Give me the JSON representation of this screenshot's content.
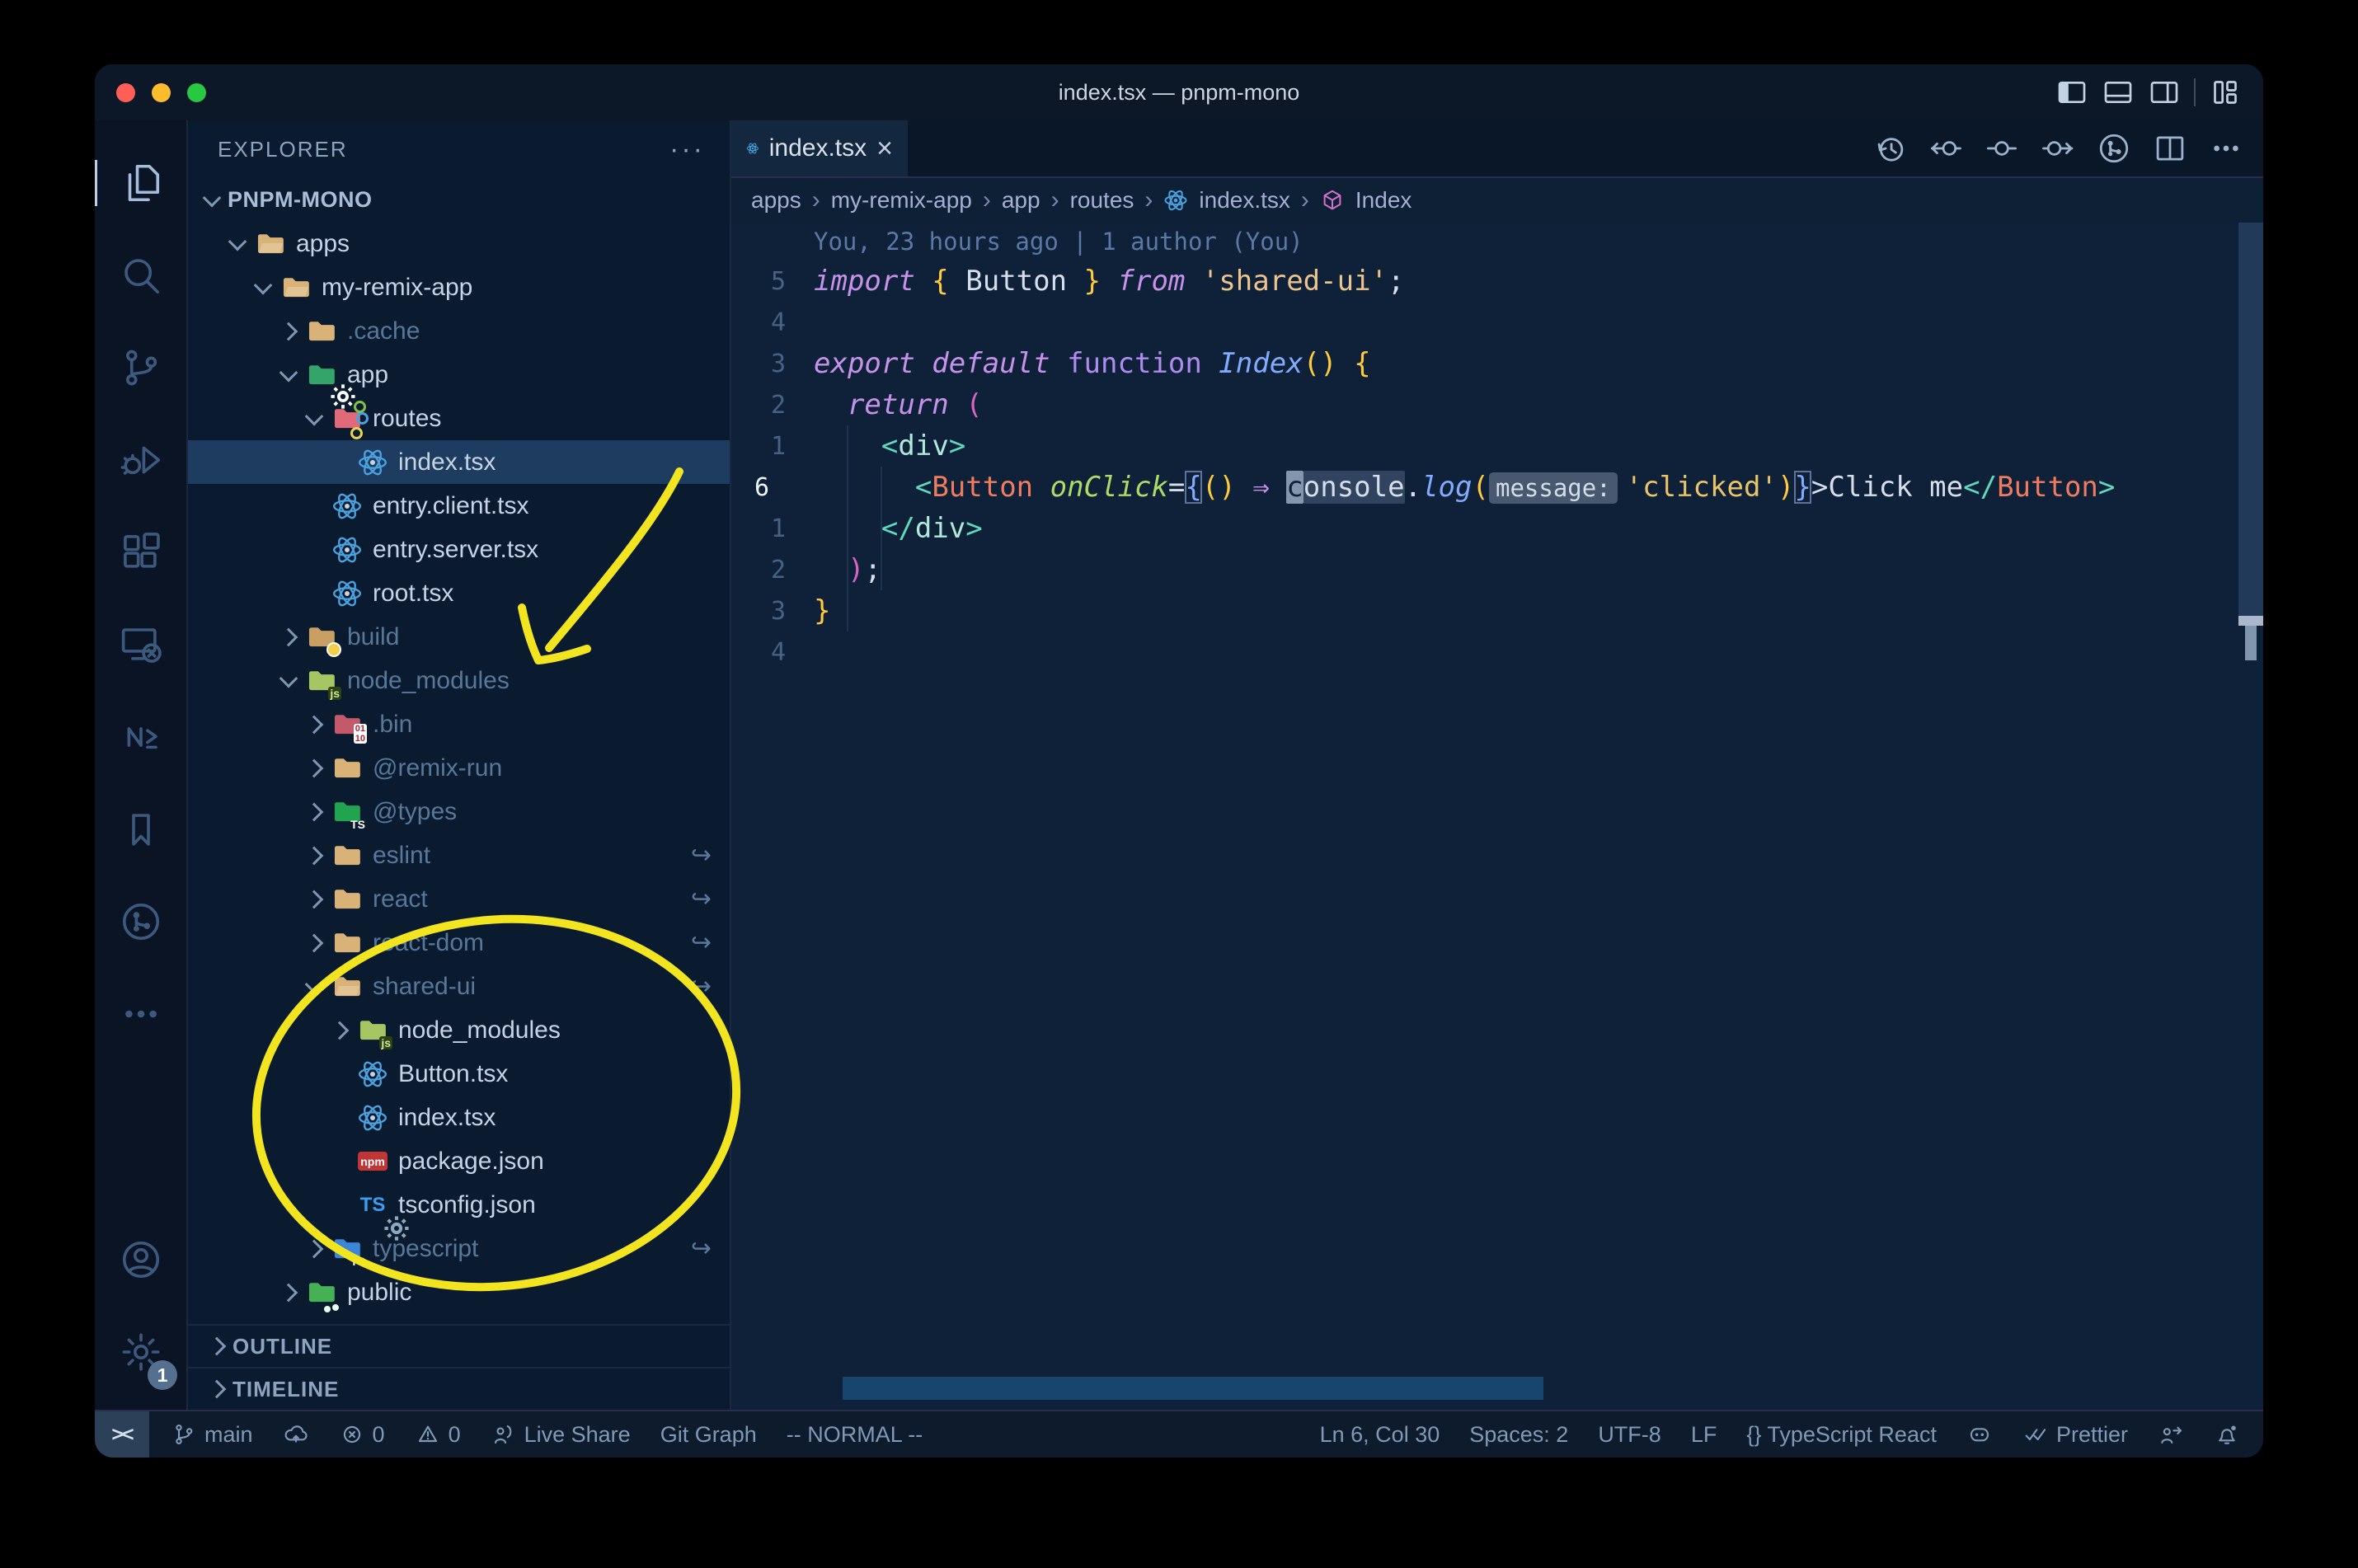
{
  "window": {
    "title": "index.tsx — pnpm-mono"
  },
  "title_bar": {
    "traffic_lights": [
      "close",
      "minimize",
      "zoom"
    ],
    "layout_icons": [
      "toggle-primary-sidebar",
      "toggle-panel",
      "toggle-secondary-sidebar",
      "customize-layout"
    ]
  },
  "activity_bar": {
    "top": [
      {
        "name": "explorer",
        "icon": "files",
        "active": true
      },
      {
        "name": "search",
        "icon": "search",
        "active": false
      },
      {
        "name": "source-control",
        "icon": "scm",
        "active": false
      },
      {
        "name": "run-debug",
        "icon": "debug",
        "active": false
      },
      {
        "name": "extensions",
        "icon": "ext",
        "active": false
      },
      {
        "name": "remote-explorer",
        "icon": "remote",
        "active": false
      },
      {
        "name": "nx-console",
        "icon": "nx",
        "active": false
      },
      {
        "name": "bookmarks",
        "icon": "bookmark",
        "active": false
      },
      {
        "name": "git-graph",
        "icon": "gitgraph",
        "active": false
      },
      {
        "name": "more-views",
        "icon": "dots",
        "active": false
      }
    ],
    "bottom": [
      {
        "name": "accounts",
        "icon": "account"
      },
      {
        "name": "settings",
        "icon": "gear",
        "badge": "1"
      }
    ]
  },
  "explorer": {
    "header": "EXPLORER",
    "section": "PNPM-MONO",
    "items": [
      {
        "label": "apps",
        "lvl": 1,
        "chev": "down",
        "icon": "folder-open",
        "dim": false
      },
      {
        "label": "my-remix-app",
        "lvl": 2,
        "chev": "down",
        "icon": "folder-open",
        "dim": false
      },
      {
        "label": ".cache",
        "lvl": 3,
        "chev": "right",
        "icon": "folder",
        "dim": true
      },
      {
        "label": "app",
        "lvl": 3,
        "chev": "down",
        "icon": "folder-app",
        "dim": false
      },
      {
        "label": "routes",
        "lvl": 4,
        "chev": "down",
        "icon": "folder-routes",
        "dim": false
      },
      {
        "label": "index.tsx",
        "lvl": 5,
        "chev": "none",
        "icon": "react",
        "dim": false,
        "selected": true
      },
      {
        "label": "entry.client.tsx",
        "lvl": 4,
        "chev": "none",
        "icon": "react",
        "dim": false
      },
      {
        "label": "entry.server.tsx",
        "lvl": 4,
        "chev": "none",
        "icon": "react",
        "dim": false
      },
      {
        "label": "root.tsx",
        "lvl": 4,
        "chev": "none",
        "icon": "react",
        "dim": false
      },
      {
        "label": "build",
        "lvl": 3,
        "chev": "right",
        "icon": "folder-build",
        "dim": true
      },
      {
        "label": "node_modules",
        "lvl": 3,
        "chev": "down",
        "icon": "folder-node",
        "dim": true
      },
      {
        "label": ".bin",
        "lvl": 4,
        "chev": "right",
        "icon": "folder-bin",
        "dim": true
      },
      {
        "label": "@remix-run",
        "lvl": 4,
        "chev": "right",
        "icon": "folder",
        "dim": true
      },
      {
        "label": "@types",
        "lvl": 4,
        "chev": "right",
        "icon": "folder-types",
        "dim": true
      },
      {
        "label": "eslint",
        "lvl": 4,
        "chev": "right",
        "icon": "folder",
        "dim": true,
        "symlink": true
      },
      {
        "label": "react",
        "lvl": 4,
        "chev": "right",
        "icon": "folder",
        "dim": true,
        "symlink": true
      },
      {
        "label": "react-dom",
        "lvl": 4,
        "chev": "right",
        "icon": "folder",
        "dim": true,
        "symlink": true
      },
      {
        "label": "shared-ui",
        "lvl": 4,
        "chev": "down",
        "icon": "folder-open",
        "dim": true,
        "symlink": true
      },
      {
        "label": "node_modules",
        "lvl": 5,
        "chev": "right",
        "icon": "folder-node",
        "dim": false
      },
      {
        "label": "Button.tsx",
        "lvl": 5,
        "chev": "none",
        "icon": "react",
        "dim": false
      },
      {
        "label": "index.tsx",
        "lvl": 5,
        "chev": "none",
        "icon": "react",
        "dim": false
      },
      {
        "label": "package.json",
        "lvl": 5,
        "chev": "none",
        "icon": "npm",
        "dim": false
      },
      {
        "label": "tsconfig.json",
        "lvl": 5,
        "chev": "none",
        "icon": "tsconfig",
        "dim": false
      },
      {
        "label": "typescript",
        "lvl": 4,
        "chev": "right",
        "icon": "folder-ts",
        "dim": true,
        "symlink": true
      },
      {
        "label": "public",
        "lvl": 3,
        "chev": "right",
        "icon": "folder-public",
        "dim": false
      }
    ],
    "panels": [
      {
        "label": "OUTLINE"
      },
      {
        "label": "TIMELINE"
      }
    ]
  },
  "tabs": [
    {
      "label": "index.tsx",
      "icon": "react",
      "close": "×",
      "active": true
    }
  ],
  "editor_actions": [
    {
      "name": "local-history",
      "icon": "history"
    },
    {
      "name": "previous-change",
      "icon": "prevchange"
    },
    {
      "name": "open-change",
      "icon": "change"
    },
    {
      "name": "next-change",
      "icon": "nextchange"
    },
    {
      "name": "git-graph-view",
      "icon": "gitgraph"
    },
    {
      "name": "split-editor",
      "icon": "split"
    },
    {
      "name": "more-actions",
      "icon": "dots"
    }
  ],
  "breadcrumbs": [
    {
      "label": "apps"
    },
    {
      "label": "my-remix-app"
    },
    {
      "label": "app"
    },
    {
      "label": "routes"
    },
    {
      "label": "index.tsx",
      "icon": "react"
    },
    {
      "label": "Index",
      "icon": "cube"
    }
  ],
  "editor": {
    "blame": "You, 23 hours ago | 1 author (You)",
    "lines": [
      {
        "n": "5",
        "segs": [
          [
            "import ",
            "kw"
          ],
          [
            "{ ",
            "yb"
          ],
          [
            "Button ",
            "wt"
          ],
          [
            "} ",
            "yb"
          ],
          [
            "from ",
            "kw"
          ],
          [
            "'shared-ui'",
            "st"
          ],
          [
            ";",
            "wt"
          ]
        ]
      },
      {
        "n": "4",
        "segs": []
      },
      {
        "n": "3",
        "segs": [
          [
            "export ",
            "kw"
          ],
          [
            "default ",
            "kw"
          ],
          [
            "function ",
            "fn"
          ],
          [
            "Index",
            "ty"
          ],
          [
            "()",
            "yb"
          ],
          [
            " ",
            "wt"
          ],
          [
            "{",
            "yb"
          ]
        ]
      },
      {
        "n": "2",
        "segs": [
          [
            "  ",
            "wt"
          ],
          [
            "return ",
            "kw"
          ],
          [
            "(",
            "pk"
          ]
        ]
      },
      {
        "n": "1",
        "segs": [
          [
            "    ",
            "wt"
          ],
          [
            "<",
            "tg"
          ],
          [
            "div",
            "dv"
          ],
          [
            ">",
            "tg"
          ]
        ]
      },
      {
        "n": "6",
        "cur": true,
        "segs": [
          [
            "      ",
            "wt"
          ],
          [
            "<",
            "tg"
          ],
          [
            "Button ",
            "cp"
          ],
          [
            "onClick",
            "at"
          ],
          [
            "=",
            "wt"
          ],
          [
            "{",
            "bm"
          ],
          [
            "()",
            "yb"
          ],
          [
            " ",
            "wt"
          ],
          [
            "⇒",
            "ar"
          ],
          [
            " ",
            "wt"
          ],
          [
            "c",
            "cur-blk"
          ],
          [
            "onsole",
            "whl"
          ],
          [
            ".",
            "wt"
          ],
          [
            "log",
            "ty"
          ],
          [
            "(",
            "yb"
          ],
          [
            "message:",
            "inlay"
          ],
          [
            "'clicked'",
            "st2"
          ],
          [
            ")",
            "yb"
          ],
          [
            "}",
            "bm"
          ],
          [
            ">Click me",
            "wt"
          ],
          [
            "</",
            "tg"
          ],
          [
            "Button",
            "cp"
          ],
          [
            ">",
            "tg"
          ]
        ]
      },
      {
        "n": "1",
        "segs": [
          [
            "    ",
            "wt"
          ],
          [
            "</",
            "tg"
          ],
          [
            "div",
            "dv"
          ],
          [
            ">",
            "tg"
          ]
        ]
      },
      {
        "n": "2",
        "segs": [
          [
            "  ",
            "wt"
          ],
          [
            ")",
            "pk"
          ],
          [
            ";",
            "wt"
          ]
        ]
      },
      {
        "n": "3",
        "segs": [
          [
            "}",
            "yb"
          ]
        ]
      },
      {
        "n": "4",
        "segs": []
      }
    ]
  },
  "status_bar": {
    "remote": "><",
    "left": [
      {
        "name": "branch",
        "icon": "branch",
        "label": "main"
      },
      {
        "name": "sync",
        "icon": "cloud",
        "label": ""
      },
      {
        "name": "errors",
        "icon": "errorc",
        "label": "0"
      },
      {
        "name": "warnings",
        "icon": "warnt",
        "label": "0"
      },
      {
        "name": "live-share",
        "icon": "liveshare",
        "label": "Live Share"
      },
      {
        "name": "git-graph",
        "icon": null,
        "label": "Git Graph"
      },
      {
        "name": "vim-mode",
        "icon": null,
        "label": "-- NORMAL --"
      }
    ],
    "right": [
      {
        "name": "cursor-position",
        "icon": null,
        "label": "Ln 6, Col 30"
      },
      {
        "name": "indentation",
        "icon": null,
        "label": "Spaces: 2"
      },
      {
        "name": "encoding",
        "icon": null,
        "label": "UTF-8"
      },
      {
        "name": "eol",
        "icon": null,
        "label": "LF"
      },
      {
        "name": "language-mode",
        "icon": null,
        "label": "{} TypeScript React"
      },
      {
        "name": "copilot",
        "icon": "copilot",
        "label": ""
      },
      {
        "name": "prettier",
        "icon": "checks",
        "label": "Prettier"
      },
      {
        "name": "feedback",
        "icon": "feedback",
        "label": ""
      },
      {
        "name": "notifications",
        "icon": "bell",
        "label": ""
      }
    ]
  },
  "annotations": [
    {
      "name": "hand-drawn-arrow",
      "color": "#f2e41f"
    },
    {
      "name": "hand-drawn-ellipse",
      "color": "#f2e41f"
    }
  ],
  "colors": {
    "traffic_red": "#ff5f57",
    "traffic_yellow": "#ffbd2e",
    "traffic_green": "#28c840",
    "selection_row": "#1d3c60",
    "accent_yellow": "#f2e41f",
    "folder_tan": "#d9b277",
    "folder_green": "#34a46b",
    "folder_routes": "#e0697a",
    "folder_node": "#a5c663",
    "folder_bin": "#c4596b",
    "folder_types": "#21a34f",
    "folder_ts": "#3b86d8",
    "folder_public": "#45b054",
    "npm_red": "#c03535",
    "react_blue": "#4aa3e0"
  }
}
